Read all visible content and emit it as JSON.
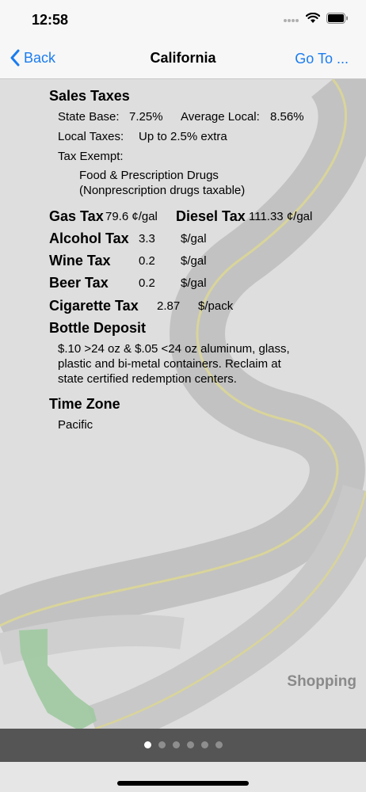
{
  "status_bar": {
    "time": "12:58",
    "icons": [
      "signal-icon",
      "wifi-icon",
      "battery-icon"
    ]
  },
  "nav": {
    "back_label": "Back",
    "title": "California",
    "goto_label": "Go To ..."
  },
  "sales_taxes": {
    "heading": "Sales Taxes",
    "state_base_label": "State Base:",
    "state_base_value": "7.25%",
    "average_local_label": "Average Local:",
    "average_local_value": "8.56%",
    "local_taxes_label": "Local Taxes:",
    "local_taxes_value": "Up to 2.5% extra",
    "tax_exempt_label": "Tax Exempt:",
    "tax_exempt_line1": "Food & Prescription Drugs",
    "tax_exempt_line2": "(Nonprescription drugs taxable)"
  },
  "fuel": {
    "gas_label": "Gas Tax",
    "gas_value": "79.6 ¢/gal",
    "diesel_label": "Diesel Tax",
    "diesel_value": "111.33 ¢/gal"
  },
  "alcohol": {
    "alcohol_label": "Alcohol Tax",
    "alcohol_value": "3.3",
    "alcohol_unit": "$/gal",
    "wine_label": "Wine Tax",
    "wine_value": "0.2",
    "wine_unit": "$/gal",
    "beer_label": "Beer Tax",
    "beer_value": "0.2",
    "beer_unit": "$/gal"
  },
  "cigarette": {
    "label": "Cigarette Tax",
    "value": "2.87",
    "unit": "$/pack"
  },
  "bottle_deposit": {
    "heading": "Bottle Deposit",
    "line1": "$.10 >24 oz & $.05 <24 oz aluminum, glass,",
    "line2": "plastic and bi-metal containers.  Reclaim at",
    "line3": "state certified redemption centers."
  },
  "time_zone": {
    "heading": "Time Zone",
    "value": "Pacific"
  },
  "shopping_label": "Shopping",
  "page_indicator": {
    "total": 6,
    "active": 0
  },
  "colors": {
    "accent": "#1a7cf0",
    "map_green": "#9fc9a0",
    "road_gray": "#b8b8b8",
    "road_yellow": "#d9d49a"
  }
}
